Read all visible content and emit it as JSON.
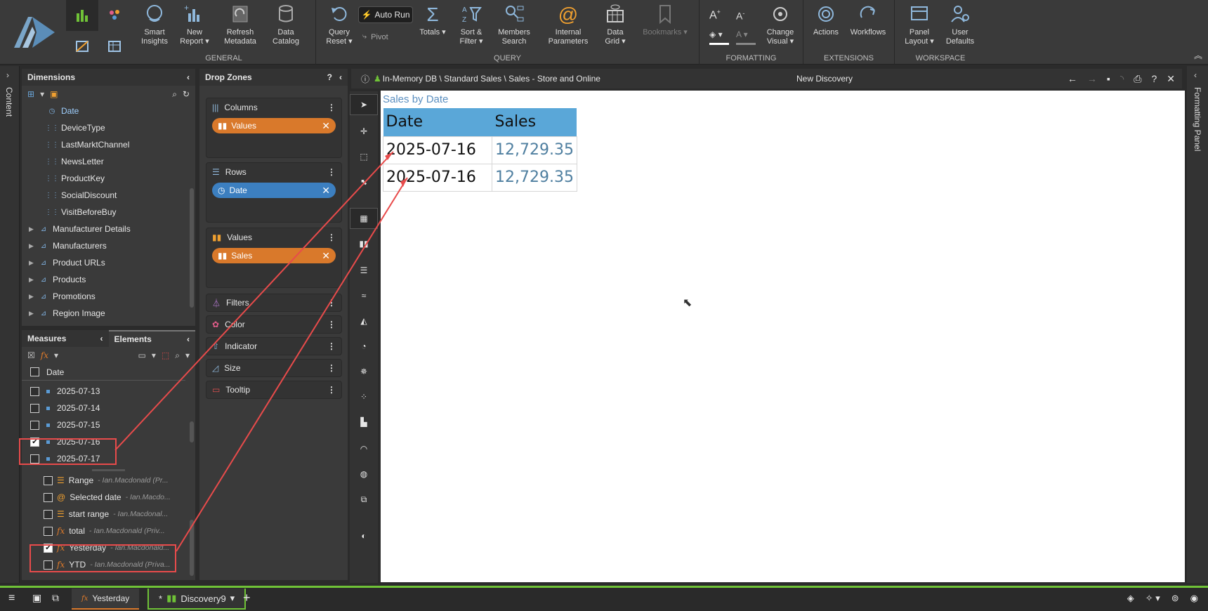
{
  "ribbon": {
    "buttons": {
      "smart_insights": "Smart\nInsights",
      "new_report": "New\nReport ▾",
      "refresh_metadata": "Refresh\nMetadata",
      "data_catalog": "Data\nCatalog",
      "query_reset": "Query\nReset ▾",
      "auto_run": "Auto Run",
      "pivot": "Pivot",
      "totals": "Totals ▾",
      "sort_filter": "Sort &\nFilter ▾",
      "members_search": "Members\nSearch",
      "internal_parameters": "Internal\nParameters",
      "data_grid": "Data\nGrid ▾",
      "bookmarks": "Bookmarks ▾",
      "change_visual": "Change\nVisual ▾",
      "actions": "Actions",
      "workflows": "Workflows",
      "panel_layout": "Panel\nLayout ▾",
      "user_defaults": "User\nDefaults"
    },
    "groups": {
      "general": "GENERAL",
      "query": "QUERY",
      "formatting": "FORMATTING",
      "extensions": "EXTENSIONS",
      "workspace": "WORKSPACE"
    }
  },
  "left_strip": {
    "label": "Content"
  },
  "right_strip": {
    "label": "Formatting Panel"
  },
  "dimensions": {
    "title": "Dimensions",
    "items": [
      {
        "label": "Date",
        "kind": "date",
        "selected": true
      },
      {
        "label": "DeviceType",
        "kind": "attr"
      },
      {
        "label": "LastMarktChannel",
        "kind": "attr"
      },
      {
        "label": "NewsLetter",
        "kind": "attr"
      },
      {
        "label": "ProductKey",
        "kind": "attr"
      },
      {
        "label": "SocialDiscount",
        "kind": "attr"
      },
      {
        "label": "VisitBeforeBuy",
        "kind": "attr"
      },
      {
        "label": "Manufacturer Details",
        "kind": "hier"
      },
      {
        "label": "Manufacturers",
        "kind": "hier"
      },
      {
        "label": "Product URLs",
        "kind": "hier"
      },
      {
        "label": "Products",
        "kind": "hier"
      },
      {
        "label": "Promotions",
        "kind": "hier"
      },
      {
        "label": "Region Image",
        "kind": "hier"
      }
    ]
  },
  "measures_panel": {
    "tab_measures": "Measures",
    "tab_elements": "Elements",
    "header": "Date",
    "elements": [
      {
        "label": "2025-07-13",
        "checked": false
      },
      {
        "label": "2025-07-14",
        "checked": false
      },
      {
        "label": "2025-07-15",
        "checked": false
      },
      {
        "label": "2025-07-16",
        "checked": true
      },
      {
        "label": "2025-07-17",
        "checked": false
      }
    ],
    "formulas": [
      {
        "label": "Range",
        "owner": "- Ian.Macdonald (Pr...",
        "checked": false,
        "icon": "list"
      },
      {
        "label": "Selected date",
        "owner": "- Ian.Macdo...",
        "checked": false,
        "icon": "at"
      },
      {
        "label": "start range",
        "owner": "- Ian.Macdonal...",
        "checked": false,
        "icon": "list"
      },
      {
        "label": "total",
        "owner": "- Ian.Macdonald (Priv...",
        "checked": false,
        "icon": "fx"
      },
      {
        "label": "Yesterday",
        "owner": "- Ian.Macdonald...",
        "checked": true,
        "icon": "fx"
      },
      {
        "label": "YTD",
        "owner": "- Ian.Macdonald (Priva...",
        "checked": false,
        "icon": "fx"
      }
    ]
  },
  "drop_zones": {
    "title": "Drop Zones",
    "columns": {
      "label": "Columns",
      "pill": "Values"
    },
    "rows": {
      "label": "Rows",
      "pill": "Date"
    },
    "values": {
      "label": "Values",
      "pill": "Sales"
    },
    "filters": "Filters",
    "color": "Color",
    "indicator": "Indicator",
    "size": "Size",
    "tooltip": "Tooltip"
  },
  "pathbar": {
    "path": "In-Memory DB \\ Standard Sales \\ Sales - Store and Online",
    "title": "New Discovery"
  },
  "grid": {
    "title": "Sales by Date",
    "headers": [
      "Date",
      "Sales"
    ],
    "rows": [
      [
        "2025-07-16",
        "12,729.35"
      ],
      [
        "2025-07-16",
        "12,729.35"
      ]
    ]
  },
  "taskbar": {
    "tab1": "Yesterday",
    "tab2": "* ",
    "tab2_name": "Discovery9"
  },
  "colors": {
    "accent_orange": "#d9792b",
    "accent_blue": "#3c7fc0",
    "annotation_red": "#e84b4b",
    "taskbar_green": "#6fc237"
  }
}
